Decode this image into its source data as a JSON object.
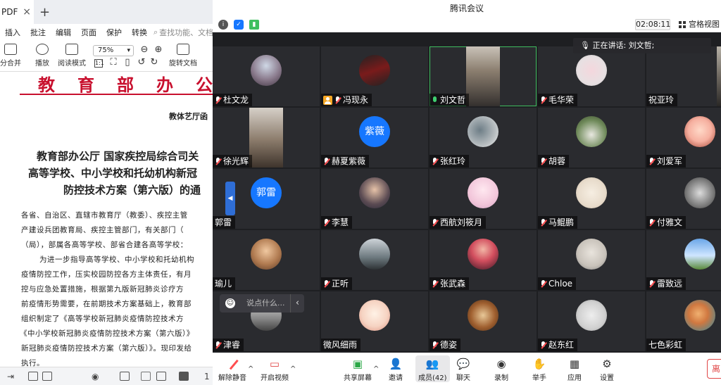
{
  "pdf": {
    "tab_label": "PDF",
    "tab_close": "×",
    "new_tab": "+",
    "menu": [
      "插入",
      "批注",
      "编辑",
      "页面",
      "保护",
      "转换"
    ],
    "search_placeholder": "查找功能、文档",
    "toolbar": {
      "merge": "分合并",
      "play": "播放",
      "read_mode": "阅读模式",
      "zoom": "75%",
      "rotate": "旋转文档"
    },
    "doc": {
      "header": "教育部办公",
      "ref": "教体艺厅函",
      "title_lines": [
        "教育部办公厅 国家疾控局综合司关",
        "高等学校、中小学校和托幼机构新冠",
        "防控技术方案（第六版）的通"
      ],
      "paragraphs": [
        "各省、自治区、直辖市教育厅（教委）、疾控主管",
        "产建设兵团教育局、疾控主管部门，有关部门（",
        "（局），部属各高等学校、部省合建各高等学校：",
        "为进一步指导高等学校、中小学校和托幼机构",
        "疫情防控工作，压实校园防控各方主体责任，有月",
        "控与应急处置措施，根据第九版新冠肺炎诊疗方",
        "前疫情形势需要，在前期技术方案基础上，教育部",
        "组织制定了《高等学校新冠肺炎疫情防控技术方",
        "《中小学校新冠肺炎疫情防控技术方案（第六版）》",
        "新冠肺炎疫情防控技术方案（第六版）》。现印发给",
        "执行。"
      ]
    }
  },
  "meeting": {
    "title": "腾讯会议",
    "timer": "02:08:11",
    "gallery_view": "宫格视图",
    "speaking_now": "正在讲话: 刘文哲;",
    "chat_placeholder": "说点什么...",
    "participants": [
      {
        "name": "杜文龙",
        "mic": "off",
        "avatar": "sunset",
        "row": 0,
        "col": 0
      },
      {
        "name": "冯现永",
        "mic": "off",
        "avatar": "car",
        "host": true,
        "row": 0,
        "col": 1
      },
      {
        "name": "刘文哲",
        "mic": "on",
        "avatar": "video-man",
        "speaking": true,
        "row": 0,
        "col": 2
      },
      {
        "name": "毛华荣",
        "mic": "off",
        "avatar": "flower",
        "row": 0,
        "col": 3
      },
      {
        "name": "祝亚玲",
        "mic": "none",
        "avatar": "video-old",
        "row": 0,
        "col": 4
      },
      {
        "name": "徐光辉",
        "mic": "off",
        "avatar": "video-glasses",
        "row": 1,
        "col": 0
      },
      {
        "name": "赫夏紫薇",
        "mic": "off",
        "avatar_text": "紫薇",
        "row": 1,
        "col": 1
      },
      {
        "name": "张红玲",
        "mic": "off",
        "avatar": "rock",
        "row": 1,
        "col": 2
      },
      {
        "name": "胡蓉",
        "mic": "off",
        "avatar": "geese",
        "row": 1,
        "col": 3
      },
      {
        "name": "刘爱军",
        "mic": "off",
        "avatar": "cartoon-girl",
        "row": 1,
        "col": 4
      },
      {
        "name": "郭雷",
        "mic": "none",
        "avatar_text": "郭雷",
        "row": 2,
        "col": 0
      },
      {
        "name": "李慧",
        "mic": "off",
        "avatar": "girl",
        "row": 2,
        "col": 1
      },
      {
        "name": "西航刘筱月",
        "mic": "off",
        "avatar": "anime",
        "row": 2,
        "col": 2
      },
      {
        "name": "马鲲鹏",
        "mic": "off",
        "avatar": "kitten",
        "row": 2,
        "col": 3
      },
      {
        "name": "付雅文",
        "mic": "off",
        "avatar": "cat",
        "row": 2,
        "col": 4
      },
      {
        "name": "瑜儿",
        "mic": "none",
        "avatar": "woman",
        "row": 3,
        "col": 0
      },
      {
        "name": "正听",
        "mic": "off",
        "avatar": "street",
        "row": 3,
        "col": 1
      },
      {
        "name": "张武森",
        "mic": "off",
        "avatar": "tree",
        "row": 3,
        "col": 2
      },
      {
        "name": "Chloe",
        "mic": "off",
        "avatar": "person",
        "row": 3,
        "col": 3
      },
      {
        "name": "雷致远",
        "mic": "off",
        "avatar": "sky",
        "row": 3,
        "col": 4
      },
      {
        "name": "津睿",
        "mic": "off",
        "avatar": "city",
        "row": 4,
        "col": 0
      },
      {
        "name": "微风细雨",
        "mic": "none",
        "avatar": "doll",
        "row": 4,
        "col": 1
      },
      {
        "name": "德姿",
        "mic": "off",
        "avatar": "beads",
        "row": 4,
        "col": 2
      },
      {
        "name": "赵东红",
        "mic": "off",
        "avatar": "bracelet",
        "row": 4,
        "col": 3
      },
      {
        "name": "七色彩虹",
        "mic": "none",
        "avatar": "leaf",
        "row": 4,
        "col": 4
      }
    ],
    "toolbar": {
      "mute": "解除静音",
      "video": "开启视频",
      "share": "共享屏幕",
      "invite": "邀请",
      "members": "成员(42)",
      "chat": "聊天",
      "record": "录制",
      "raise_hand": "举手",
      "apps": "应用",
      "settings": "设置",
      "leave": "离"
    }
  },
  "status_bar": {
    "page_label": "1",
    "page_label_2": "1"
  }
}
